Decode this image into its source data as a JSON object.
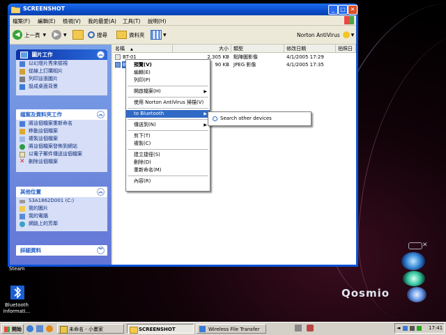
{
  "window": {
    "title": "SCREENSHOT"
  },
  "menubar": [
    "檔案(F)",
    "編輯(E)",
    "檢視(V)",
    "我的最愛(A)",
    "工具(T)",
    "說明(H)"
  ],
  "toolbar": {
    "back": "上一頁",
    "search": "搜尋",
    "folders": "資料夾",
    "norton": "Norton AntiVirus"
  },
  "taskpane": {
    "picture_tasks": {
      "title": "圖片工作",
      "items": [
        "以幻燈片秀來檢視",
        "從線上訂購相片",
        "列印這張圖片",
        "設成桌面背景"
      ]
    },
    "file_tasks": {
      "title": "檔案及資料夾工作",
      "items": [
        "將這個檔案重新命名",
        "移動這個檔案",
        "複製這個檔案",
        "將這個檔案發佈到網站",
        "以電子郵件傳送這個檔案",
        "刪除這個檔案"
      ]
    },
    "other_places": {
      "title": "其他位置",
      "items": [
        "S3A1862D001 (C:)",
        "我的圖片",
        "我的電腦",
        "網路上的芳鄰"
      ]
    },
    "details": {
      "title": "詳細資料"
    }
  },
  "columns": [
    "名稱",
    "大小",
    "類型",
    "修改日期",
    "拍照日"
  ],
  "files": [
    {
      "name": "BT-01",
      "size": "2,305 KB",
      "type": "點陣圖影像",
      "modified": "4/1/2005 17:29"
    },
    {
      "name": "BT-01",
      "size": "90 KB",
      "type": "JPEG 影像",
      "modified": "4/1/2005 17:35"
    }
  ],
  "context_menu": {
    "items": [
      {
        "label": "預覽(V)",
        "bold": true
      },
      {
        "label": "編輯(E)"
      },
      {
        "label": "列印(P)"
      },
      {
        "sep": true
      },
      {
        "label": "開啟檔案(H)",
        "arrow": true
      },
      {
        "sep": true
      },
      {
        "label": "使用 Norton AntiVirus 掃描(V)"
      },
      {
        "sep": true
      },
      {
        "label": "to Bluetooth",
        "arrow": true,
        "highlight": true
      },
      {
        "sep": true
      },
      {
        "label": "傳送到(N)",
        "arrow": true
      },
      {
        "sep": true
      },
      {
        "label": "剪下(T)"
      },
      {
        "label": "複製(C)"
      },
      {
        "sep": true
      },
      {
        "label": "建立捷徑(S)"
      },
      {
        "label": "刪除(D)"
      },
      {
        "label": "重新命名(M)"
      },
      {
        "sep": true
      },
      {
        "label": "內容(R)"
      }
    ],
    "submenu": [
      "Search other devices"
    ]
  },
  "desktop": {
    "bluetooth_label": "Bluetooth Informati...",
    "steam_label": "Steam",
    "logo": "Qosmio"
  },
  "taskbar": {
    "start": "開始",
    "tasks": [
      "未命名 - 小畫家",
      "SCREENSHOT",
      "Wireless File Transfer"
    ],
    "clock": "17:41"
  },
  "colors": {
    "title_blue": "#0a52d6",
    "highlight": "#316ac5",
    "taskpane": "#6b86dc"
  }
}
